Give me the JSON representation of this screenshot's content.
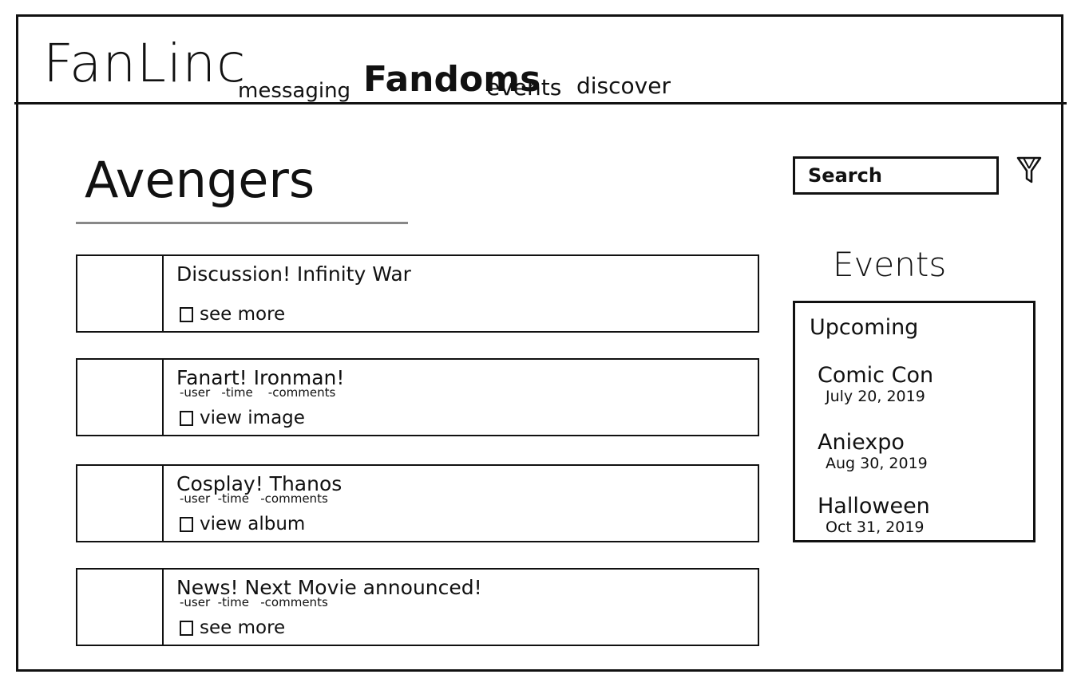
{
  "header": {
    "logo": "FanLinc",
    "nav": {
      "messaging": "messaging",
      "fandoms": "Fandoms",
      "events": "events",
      "discover": "discover"
    }
  },
  "page": {
    "title": "Avengers"
  },
  "posts": [
    {
      "title": "Discussion! Infinity War",
      "meta": "",
      "action": "see more"
    },
    {
      "title": "Fanart! Ironman!",
      "meta": "-user   -time    -comments",
      "action": "view image"
    },
    {
      "title": "Cosplay! Thanos",
      "meta": "-user  -time   -comments",
      "action": "view album"
    },
    {
      "title": "News! Next Movie announced!",
      "meta": "-user  -time   -comments",
      "action": "see more"
    }
  ],
  "search": {
    "placeholder": "Search",
    "filter_icon": "filter-icon"
  },
  "events": {
    "heading": "Events",
    "subheading": "Upcoming",
    "items": [
      {
        "name": "Comic Con",
        "date": "July 20, 2019"
      },
      {
        "name": "Aniexpo",
        "date": "Aug 30, 2019"
      },
      {
        "name": "Halloween",
        "date": "Oct 31, 2019"
      }
    ]
  }
}
